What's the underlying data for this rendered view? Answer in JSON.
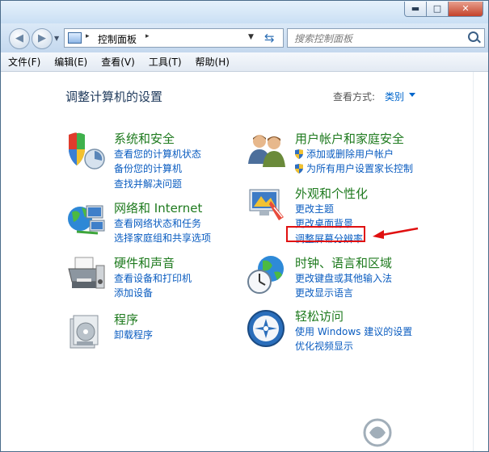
{
  "window": {
    "title_buttons": {
      "minimize": "▬",
      "maximize": "□",
      "close": "✕"
    }
  },
  "nav": {
    "back_icon": "back-arrow-icon",
    "forward_icon": "forward-arrow-icon",
    "address": {
      "path": "控制面板",
      "separator": "▸"
    },
    "search_placeholder": "搜索控制面板"
  },
  "menubar": {
    "items": [
      "文件(F)",
      "编辑(E)",
      "查看(V)",
      "工具(T)",
      "帮助(H)"
    ]
  },
  "main": {
    "title": "调整计算机的设置",
    "view_by_label": "查看方式:",
    "view_by_value": "类别"
  },
  "categories": [
    {
      "title": "系统和安全",
      "icon": "system-security-icon",
      "links": [
        "查看您的计算机状态",
        "备份您的计算机",
        "查找并解决问题"
      ]
    },
    {
      "title": "网络和 Internet",
      "icon": "network-icon",
      "links": [
        "查看网络状态和任务",
        "选择家庭组和共享选项"
      ]
    },
    {
      "title": "硬件和声音",
      "icon": "printer-icon",
      "links": [
        "查看设备和打印机",
        "添加设备"
      ]
    },
    {
      "title": "程序",
      "icon": "programs-icon",
      "links": [
        "卸载程序"
      ]
    },
    {
      "title": "用户帐户和家庭安全",
      "icon": "users-icon",
      "links": [
        "添加或删除用户帐户",
        "为所有用户设置家长控制"
      ]
    },
    {
      "title": "外观和个性化",
      "icon": "appearance-icon",
      "links": [
        "更改主题",
        "更改桌面背景",
        "调整屏幕分辨率"
      ]
    },
    {
      "title": "时钟、语言和区域",
      "icon": "clock-globe-icon",
      "links": [
        "更改键盘或其他输入法",
        "更改显示语言"
      ]
    },
    {
      "title": "轻松访问",
      "icon": "ease-of-access-icon",
      "links": [
        "使用 Windows 建议的设置",
        "优化视频显示"
      ]
    }
  ],
  "colors": {
    "category_title": "#1e7a1e",
    "link": "#0a5cc0",
    "highlight": "#e01010"
  }
}
